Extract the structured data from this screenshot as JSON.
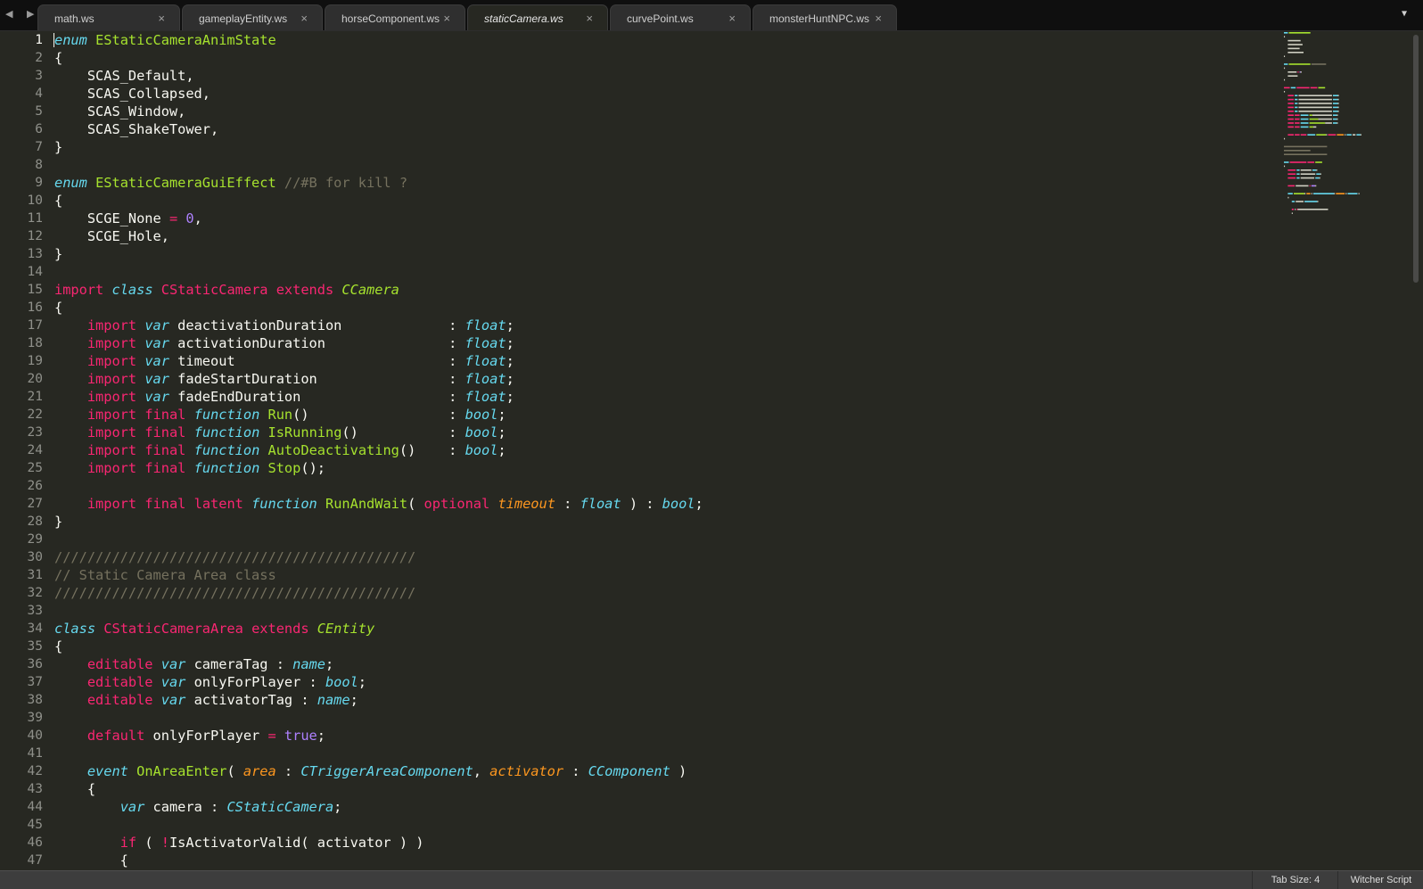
{
  "tabs": [
    {
      "label": "math.ws",
      "active": false
    },
    {
      "label": "gameplayEntity.ws",
      "active": false
    },
    {
      "label": "horseComponent.ws",
      "active": false
    },
    {
      "label": "staticCamera.ws",
      "active": true
    },
    {
      "label": "curvePoint.ws",
      "active": false
    },
    {
      "label": "monsterHuntNPC.ws",
      "active": false
    }
  ],
  "tab_close_glyph": "×",
  "nav_arrows": "◀ ▶",
  "tab_menu_glyph": "▼",
  "current_line": 1,
  "code_lines": [
    [
      [
        "s",
        "enum"
      ],
      [
        "t",
        " "
      ],
      [
        "e",
        "EStaticCameraAnimState"
      ]
    ],
    [
      [
        "t",
        "{"
      ]
    ],
    [
      [
        "t",
        "    SCAS_Default,"
      ]
    ],
    [
      [
        "t",
        "    SCAS_Collapsed,"
      ]
    ],
    [
      [
        "t",
        "    SCAS_Window,"
      ]
    ],
    [
      [
        "t",
        "    SCAS_ShakeTower,"
      ]
    ],
    [
      [
        "t",
        "}"
      ]
    ],
    [],
    [
      [
        "s",
        "enum"
      ],
      [
        "t",
        " "
      ],
      [
        "e",
        "EStaticCameraGuiEffect"
      ],
      [
        "t",
        " "
      ],
      [
        "c",
        "//#B for kill ?"
      ]
    ],
    [
      [
        "t",
        "{"
      ]
    ],
    [
      [
        "t",
        "    SCGE_None "
      ],
      [
        "k",
        "="
      ],
      [
        "t",
        " "
      ],
      [
        "n",
        "0"
      ],
      [
        "t",
        ","
      ]
    ],
    [
      [
        "t",
        "    SCGE_Hole,"
      ]
    ],
    [
      [
        "t",
        "}"
      ]
    ],
    [],
    [
      [
        "k",
        "import"
      ],
      [
        "t",
        " "
      ],
      [
        "s",
        "class"
      ],
      [
        "t",
        " "
      ],
      [
        "k",
        "CStaticCamera"
      ],
      [
        "t",
        " "
      ],
      [
        "k",
        "extends"
      ],
      [
        "t",
        " "
      ],
      [
        "ei",
        "CCamera"
      ]
    ],
    [
      [
        "t",
        "{"
      ]
    ],
    [
      [
        "t",
        "    "
      ],
      [
        "k",
        "import"
      ],
      [
        "t",
        " "
      ],
      [
        "s",
        "var"
      ],
      [
        "t",
        " deactivationDuration             : "
      ],
      [
        "s",
        "float"
      ],
      [
        "t",
        ";"
      ]
    ],
    [
      [
        "t",
        "    "
      ],
      [
        "k",
        "import"
      ],
      [
        "t",
        " "
      ],
      [
        "s",
        "var"
      ],
      [
        "t",
        " activationDuration               : "
      ],
      [
        "s",
        "float"
      ],
      [
        "t",
        ";"
      ]
    ],
    [
      [
        "t",
        "    "
      ],
      [
        "k",
        "import"
      ],
      [
        "t",
        " "
      ],
      [
        "s",
        "var"
      ],
      [
        "t",
        " timeout                          : "
      ],
      [
        "s",
        "float"
      ],
      [
        "t",
        ";"
      ]
    ],
    [
      [
        "t",
        "    "
      ],
      [
        "k",
        "import"
      ],
      [
        "t",
        " "
      ],
      [
        "s",
        "var"
      ],
      [
        "t",
        " fadeStartDuration                : "
      ],
      [
        "s",
        "float"
      ],
      [
        "t",
        ";"
      ]
    ],
    [
      [
        "t",
        "    "
      ],
      [
        "k",
        "import"
      ],
      [
        "t",
        " "
      ],
      [
        "s",
        "var"
      ],
      [
        "t",
        " fadeEndDuration                  : "
      ],
      [
        "s",
        "float"
      ],
      [
        "t",
        ";"
      ]
    ],
    [
      [
        "t",
        "    "
      ],
      [
        "k",
        "import"
      ],
      [
        "t",
        " "
      ],
      [
        "k",
        "final"
      ],
      [
        "t",
        " "
      ],
      [
        "s",
        "function"
      ],
      [
        "t",
        " "
      ],
      [
        "e",
        "Run"
      ],
      [
        "t",
        "()                 : "
      ],
      [
        "s",
        "bool"
      ],
      [
        "t",
        ";"
      ]
    ],
    [
      [
        "t",
        "    "
      ],
      [
        "k",
        "import"
      ],
      [
        "t",
        " "
      ],
      [
        "k",
        "final"
      ],
      [
        "t",
        " "
      ],
      [
        "s",
        "function"
      ],
      [
        "t",
        " "
      ],
      [
        "e",
        "IsRunning"
      ],
      [
        "t",
        "()           : "
      ],
      [
        "s",
        "bool"
      ],
      [
        "t",
        ";"
      ]
    ],
    [
      [
        "t",
        "    "
      ],
      [
        "k",
        "import"
      ],
      [
        "t",
        " "
      ],
      [
        "k",
        "final"
      ],
      [
        "t",
        " "
      ],
      [
        "s",
        "function"
      ],
      [
        "t",
        " "
      ],
      [
        "e",
        "AutoDeactivating"
      ],
      [
        "t",
        "()    : "
      ],
      [
        "s",
        "bool"
      ],
      [
        "t",
        ";"
      ]
    ],
    [
      [
        "t",
        "    "
      ],
      [
        "k",
        "import"
      ],
      [
        "t",
        " "
      ],
      [
        "k",
        "final"
      ],
      [
        "t",
        " "
      ],
      [
        "s",
        "function"
      ],
      [
        "t",
        " "
      ],
      [
        "e",
        "Stop"
      ],
      [
        "t",
        "();"
      ]
    ],
    [],
    [
      [
        "t",
        "    "
      ],
      [
        "k",
        "import"
      ],
      [
        "t",
        " "
      ],
      [
        "k",
        "final"
      ],
      [
        "t",
        " "
      ],
      [
        "k",
        "latent"
      ],
      [
        "t",
        " "
      ],
      [
        "s",
        "function"
      ],
      [
        "t",
        " "
      ],
      [
        "e",
        "RunAndWait"
      ],
      [
        "t",
        "( "
      ],
      [
        "k",
        "optional"
      ],
      [
        "t",
        " "
      ],
      [
        "p",
        "timeout"
      ],
      [
        "t",
        " : "
      ],
      [
        "s",
        "float"
      ],
      [
        "t",
        " ) : "
      ],
      [
        "s",
        "bool"
      ],
      [
        "t",
        ";"
      ]
    ],
    [
      [
        "t",
        "}"
      ]
    ],
    [],
    [
      [
        "c",
        "////////////////////////////////////////////"
      ]
    ],
    [
      [
        "c",
        "// Static Camera Area class"
      ]
    ],
    [
      [
        "c",
        "////////////////////////////////////////////"
      ]
    ],
    [],
    [
      [
        "s",
        "class"
      ],
      [
        "t",
        " "
      ],
      [
        "k",
        "CStaticCameraArea"
      ],
      [
        "t",
        " "
      ],
      [
        "k",
        "extends"
      ],
      [
        "t",
        " "
      ],
      [
        "ei",
        "CEntity"
      ]
    ],
    [
      [
        "t",
        "{"
      ]
    ],
    [
      [
        "t",
        "    "
      ],
      [
        "k",
        "editable"
      ],
      [
        "t",
        " "
      ],
      [
        "s",
        "var"
      ],
      [
        "t",
        " cameraTag : "
      ],
      [
        "s",
        "name"
      ],
      [
        "t",
        ";"
      ]
    ],
    [
      [
        "t",
        "    "
      ],
      [
        "k",
        "editable"
      ],
      [
        "t",
        " "
      ],
      [
        "s",
        "var"
      ],
      [
        "t",
        " onlyForPlayer : "
      ],
      [
        "s",
        "bool"
      ],
      [
        "t",
        ";"
      ]
    ],
    [
      [
        "t",
        "    "
      ],
      [
        "k",
        "editable"
      ],
      [
        "t",
        " "
      ],
      [
        "s",
        "var"
      ],
      [
        "t",
        " activatorTag : "
      ],
      [
        "s",
        "name"
      ],
      [
        "t",
        ";"
      ]
    ],
    [],
    [
      [
        "t",
        "    "
      ],
      [
        "k",
        "default"
      ],
      [
        "t",
        " onlyForPlayer "
      ],
      [
        "k",
        "="
      ],
      [
        "t",
        " "
      ],
      [
        "n",
        "true"
      ],
      [
        "t",
        ";"
      ]
    ],
    [],
    [
      [
        "t",
        "    "
      ],
      [
        "s",
        "event"
      ],
      [
        "t",
        " "
      ],
      [
        "e",
        "OnAreaEnter"
      ],
      [
        "t",
        "( "
      ],
      [
        "p",
        "area"
      ],
      [
        "t",
        " : "
      ],
      [
        "s",
        "CTriggerAreaComponent"
      ],
      [
        "t",
        ", "
      ],
      [
        "p",
        "activator"
      ],
      [
        "t",
        " : "
      ],
      [
        "s",
        "CComponent"
      ],
      [
        "t",
        " )"
      ]
    ],
    [
      [
        "t",
        "    {"
      ]
    ],
    [
      [
        "t",
        "        "
      ],
      [
        "s",
        "var"
      ],
      [
        "t",
        " camera : "
      ],
      [
        "s",
        "CStaticCamera"
      ],
      [
        "t",
        ";"
      ]
    ],
    [],
    [
      [
        "t",
        "        "
      ],
      [
        "k",
        "if"
      ],
      [
        "t",
        " ( "
      ],
      [
        "k",
        "!"
      ],
      [
        "t",
        "IsActivatorValid( activator ) )"
      ]
    ],
    [
      [
        "t",
        "        {"
      ]
    ]
  ],
  "status": {
    "tab_size": "Tab Size: 4",
    "syntax": "Witcher Script"
  }
}
